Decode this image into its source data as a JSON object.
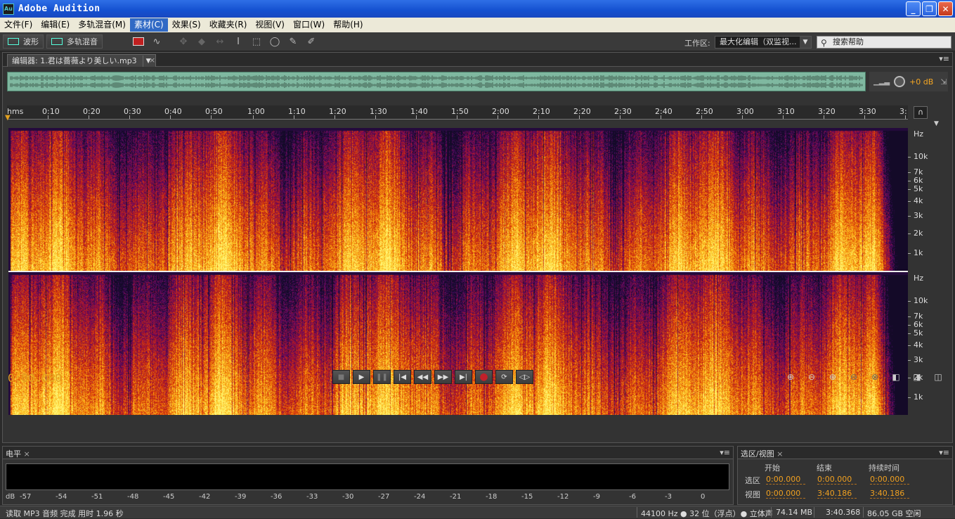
{
  "window": {
    "title": "Adobe Audition",
    "icon_text": "Au"
  },
  "menu": [
    "文件(F)",
    "编辑(E)",
    "多轨混音(M)",
    "素材(C)",
    "效果(S)",
    "收藏夹(R)",
    "视图(V)",
    "窗口(W)",
    "帮助(H)"
  ],
  "menu_active_index": 3,
  "toolbar": {
    "waveform_label": "波形",
    "multitrack_label": "多轨混音",
    "workspace_label": "工作区:",
    "workspace_value": "最大化编辑（双监视...",
    "search_placeholder": "搜索帮助"
  },
  "editor": {
    "tab_label": "编辑器: 1.君は薔薇より美しい.mp3",
    "overview_db": "+0 dB",
    "ruler_unit": "hms",
    "ruler_ticks": [
      "0:10",
      "0:20",
      "0:30",
      "0:40",
      "0:50",
      "1:00",
      "1:10",
      "1:20",
      "1:30",
      "1:40",
      "1:50",
      "2:00",
      "2:10",
      "2:20",
      "2:30",
      "2:40",
      "2:50",
      "3:00",
      "3:10",
      "3:20",
      "3:30",
      "3:"
    ],
    "hz_unit": "Hz",
    "hz_labels": [
      "10k",
      "7k",
      "6k",
      "5k",
      "4k",
      "3k",
      "2k",
      "1k"
    ],
    "current_time": "0:00.000"
  },
  "levels": {
    "title": "电平",
    "db_labels": [
      "dB",
      "-57",
      "-54",
      "-51",
      "-48",
      "-45",
      "-42",
      "-39",
      "-36",
      "-33",
      "-30",
      "-27",
      "-24",
      "-21",
      "-18",
      "-15",
      "-12",
      "-9",
      "-6",
      "-3",
      "0"
    ]
  },
  "selection_view": {
    "title": "选区/视图",
    "headers": [
      "开始",
      "结束",
      "持续时间"
    ],
    "rows": [
      {
        "label": "选区",
        "start": "0:00.000",
        "end": "0:00.000",
        "duration": "0:00.000"
      },
      {
        "label": "视图",
        "start": "0:00.000",
        "end": "3:40.186",
        "duration": "3:40.186"
      }
    ]
  },
  "status": {
    "message": "读取 MP3 音频 完成 用时 1.96 秒",
    "format": "44100 Hz ● 32 位（浮点）● 立体声",
    "size": "74.14 MB",
    "duration": "3:40.368",
    "free_space": "86.05 GB 空闲"
  }
}
